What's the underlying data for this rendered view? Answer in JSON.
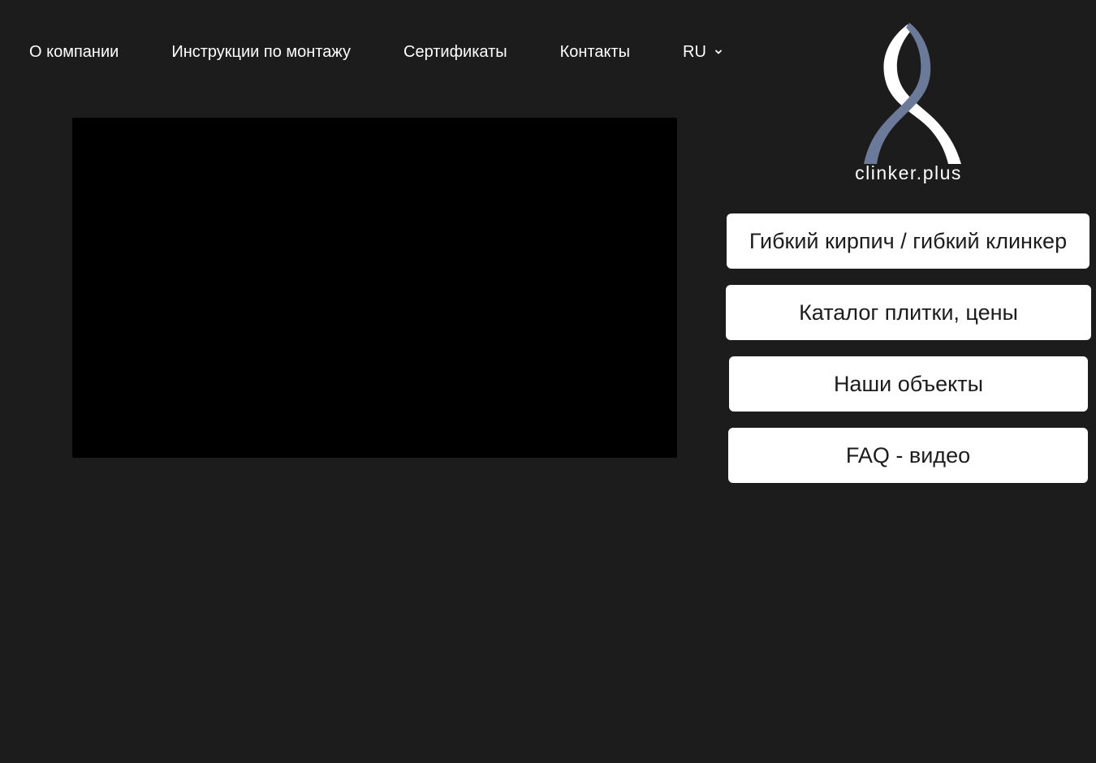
{
  "nav": {
    "items": [
      {
        "label": "О компании"
      },
      {
        "label": "Инструкции по монтажу"
      },
      {
        "label": "Сертификаты"
      },
      {
        "label": "Контакты"
      }
    ],
    "language": {
      "label": "RU",
      "icon": "chevron-down-icon"
    }
  },
  "logo": {
    "text": "clinker.plus",
    "colors": {
      "primary": "#ffffff",
      "secondary": "#6b7a99"
    }
  },
  "sidebar": {
    "buttons": [
      {
        "label": "Гибкий кирпич / гибкий клинкер"
      },
      {
        "label": "Каталог плитки, цены"
      },
      {
        "label": "Наши объекты"
      },
      {
        "label": "FAQ - видео"
      }
    ]
  },
  "colors": {
    "background": "#1c1c1c",
    "video": "#000000",
    "button_bg": "#ffffff",
    "button_text": "#1c1c1c"
  }
}
